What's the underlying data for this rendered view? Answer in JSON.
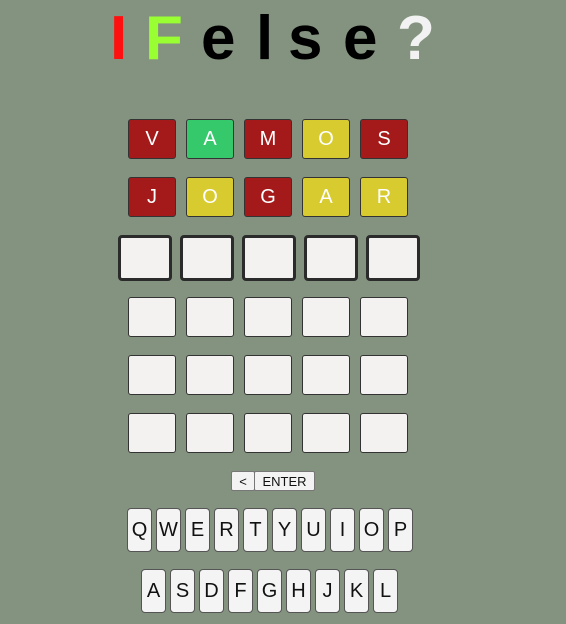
{
  "title": {
    "letters": [
      {
        "char": "I",
        "color": "#ff1010"
      },
      {
        "char": "F",
        "color": "#99ff33"
      },
      {
        "char": "e",
        "color": "#000000"
      },
      {
        "char": "l",
        "color": "#000000"
      },
      {
        "char": "s",
        "color": "#000000"
      },
      {
        "char": "e",
        "color": "#000000"
      },
      {
        "char": "?",
        "color": "#f2f2f2"
      }
    ]
  },
  "board": {
    "rows": [
      [
        {
          "letter": "V",
          "state": "red"
        },
        {
          "letter": "A",
          "state": "green"
        },
        {
          "letter": "M",
          "state": "red"
        },
        {
          "letter": "O",
          "state": "yellow"
        },
        {
          "letter": "S",
          "state": "red"
        }
      ],
      [
        {
          "letter": "J",
          "state": "red"
        },
        {
          "letter": "O",
          "state": "yellow"
        },
        {
          "letter": "G",
          "state": "red"
        },
        {
          "letter": "A",
          "state": "yellow"
        },
        {
          "letter": "R",
          "state": "yellow"
        }
      ],
      [
        {
          "letter": "",
          "state": "active"
        },
        {
          "letter": "",
          "state": "active"
        },
        {
          "letter": "",
          "state": "active"
        },
        {
          "letter": "",
          "state": "active"
        },
        {
          "letter": "",
          "state": "active"
        }
      ],
      [
        {
          "letter": "",
          "state": "empty"
        },
        {
          "letter": "",
          "state": "empty"
        },
        {
          "letter": "",
          "state": "empty"
        },
        {
          "letter": "",
          "state": "empty"
        },
        {
          "letter": "",
          "state": "empty"
        }
      ],
      [
        {
          "letter": "",
          "state": "empty"
        },
        {
          "letter": "",
          "state": "empty"
        },
        {
          "letter": "",
          "state": "empty"
        },
        {
          "letter": "",
          "state": "empty"
        },
        {
          "letter": "",
          "state": "empty"
        }
      ],
      [
        {
          "letter": "",
          "state": "empty"
        },
        {
          "letter": "",
          "state": "empty"
        },
        {
          "letter": "",
          "state": "empty"
        },
        {
          "letter": "",
          "state": "empty"
        },
        {
          "letter": "",
          "state": "empty"
        }
      ]
    ]
  },
  "controls": {
    "backspace_label": "<",
    "enter_label": "ENTER"
  },
  "keyboard": {
    "row1": [
      "Q",
      "W",
      "E",
      "R",
      "T",
      "Y",
      "U",
      "I",
      "O",
      "P"
    ],
    "row2": [
      "A",
      "S",
      "D",
      "F",
      "G",
      "H",
      "J",
      "K",
      "L"
    ]
  }
}
